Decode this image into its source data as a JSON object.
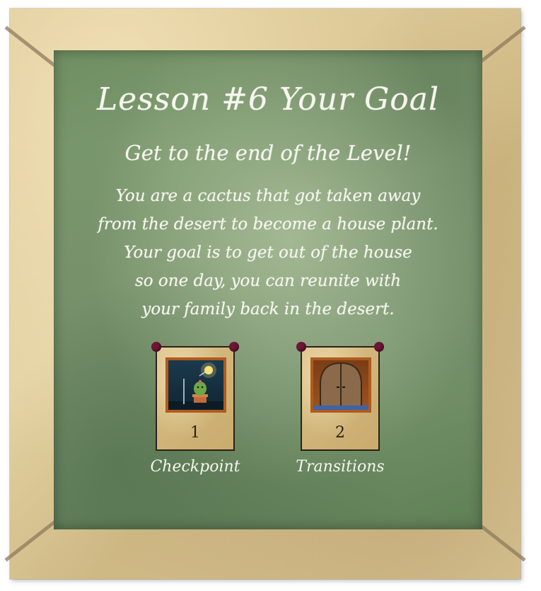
{
  "lesson": {
    "title": "Lesson #6 Your Goal",
    "subtitle": "Get to the end of the Level!",
    "story_lines": [
      "You are a cactus that got taken away",
      "from the desert to become a house plant.",
      "Your goal is to get out of the house",
      "so one day, you can reunite with",
      "your family back in the desert."
    ]
  },
  "cards": [
    {
      "number": "1",
      "label": "Checkpoint",
      "picture": "cactus-lamp-icon"
    },
    {
      "number": "2",
      "label": "Transitions",
      "picture": "arched-door-icon"
    }
  ],
  "colors": {
    "chalkboard": "#7a9670",
    "frame": "#d9c594",
    "pin": "#6e1636",
    "chalk_text": "#f6f6ee"
  }
}
